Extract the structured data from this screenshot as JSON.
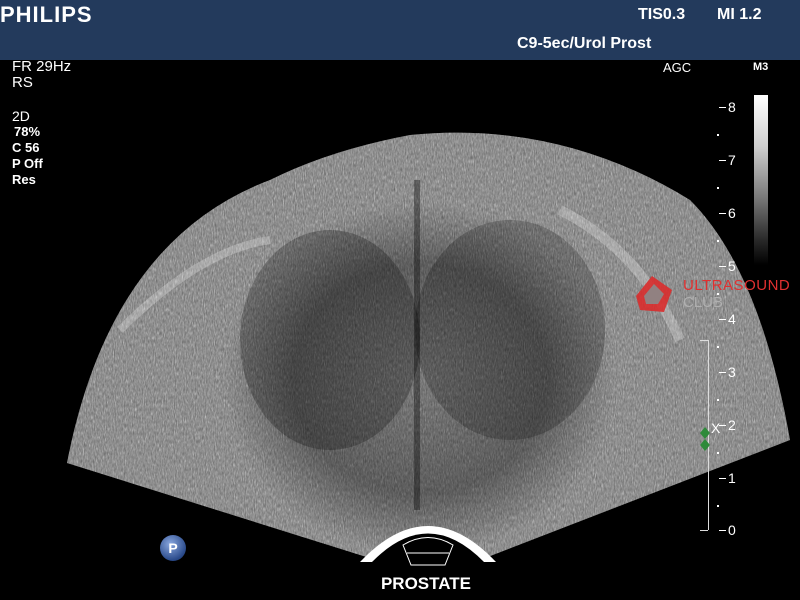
{
  "header": {
    "brand": "PHILIPS",
    "tis": "TIS0.3",
    "mi": "MI 1.2",
    "probe_preset": "C9-5ec/Urol Prost"
  },
  "left_panel": {
    "frame_rate": "FR 29Hz",
    "rs": "RS",
    "mode": "2D",
    "gain": "78%",
    "compression": "C 56",
    "persistence": "P Off",
    "resolution": "Res"
  },
  "right_panel": {
    "agc": "AGC",
    "map": "M3",
    "depth_scale": [
      "8",
      "7",
      "6",
      "5",
      "4",
      "3",
      "2",
      "1",
      "0"
    ],
    "focus_marker": "X"
  },
  "watermark": {
    "line1": "ULTRASOUND",
    "line2": "CLUB"
  },
  "p_button": "P",
  "organ_label": "PROSTATE",
  "colors": {
    "header_bg": "#233a5c",
    "watermark_red": "#e03030",
    "focus_green": "#2e8a3a"
  },
  "icons": {
    "probe_icon": "probe-icon",
    "watermark_logo": "ultrasound-club-logo-icon",
    "focus_marker": "focus-position-icon"
  }
}
